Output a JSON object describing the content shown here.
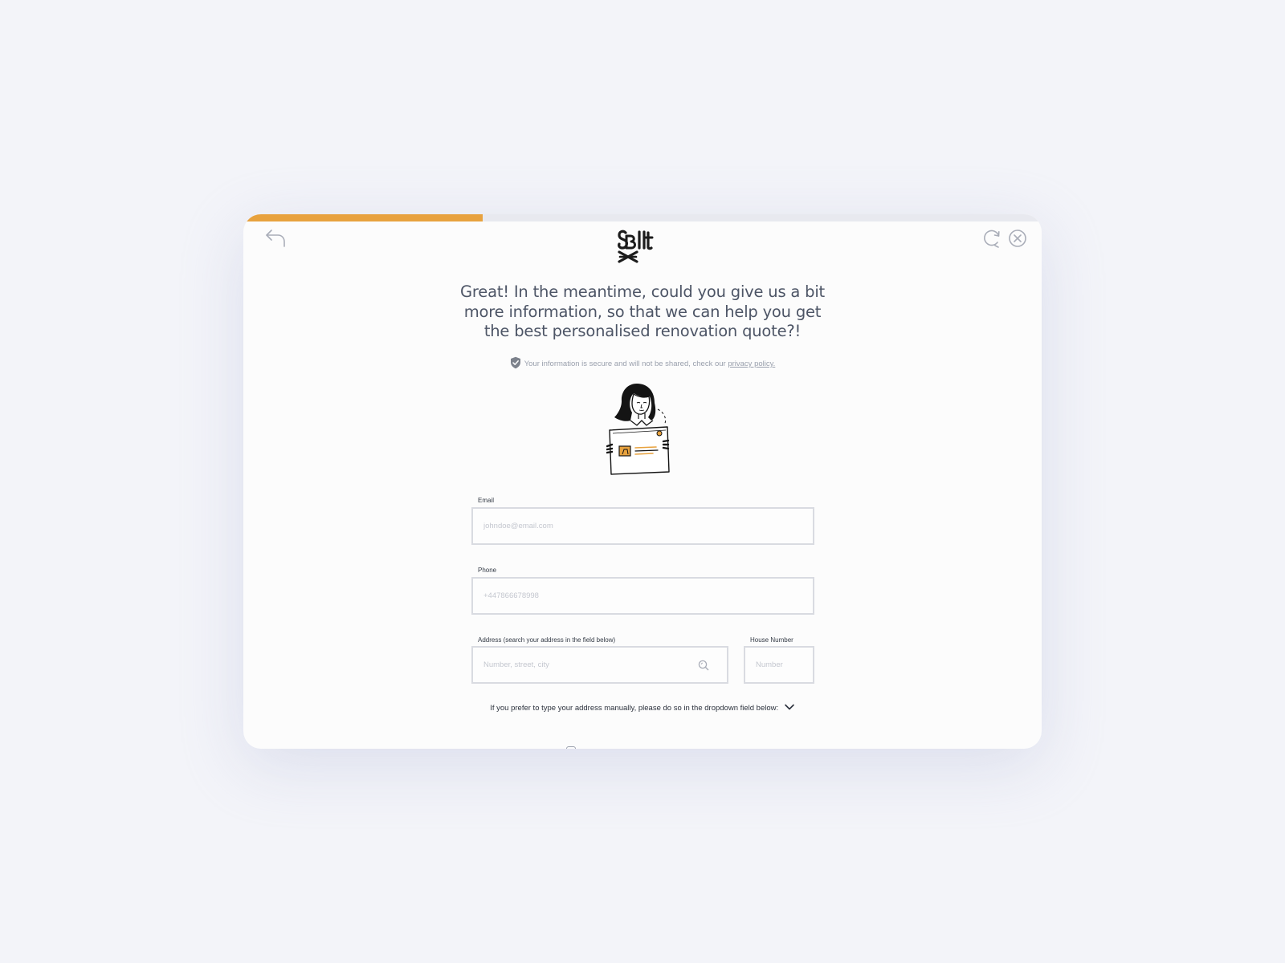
{
  "progress": {
    "value_percent": 30,
    "fill_color": "#e8a23e",
    "track_color": "#e8e9ef"
  },
  "header": {
    "back_icon": "back-arrow-icon",
    "logo_text": "Bilt",
    "refresh_icon": "refresh-icon",
    "close_icon": "close-icon"
  },
  "headline": "Great! In the meantime, could you give us a bit more information, so that we can help you get the best personalised renovation quote?!",
  "secure_note": {
    "icon": "shield-check-icon",
    "text": "Your information is secure and will not be shared, check our ",
    "link_text": "privacy policy."
  },
  "illustration": {
    "icon": "woman-holding-id-card-illustration",
    "accent_color": "#e8a23e"
  },
  "form": {
    "email": {
      "label": "Email",
      "placeholder": "johndoe@email.com",
      "value": ""
    },
    "phone": {
      "label": "Phone",
      "placeholder": "+447866678998",
      "value": ""
    },
    "address": {
      "label": "Address (search your address in the field below)",
      "placeholder": "Number, street, city",
      "value": "",
      "icon": "search-icon"
    },
    "house_number": {
      "label": "House Number",
      "placeholder": "Number",
      "value": ""
    }
  },
  "manual_address": {
    "text": "If you prefer to type your address manually, please do so in the dropdown field below:",
    "icon": "chevron-down-icon"
  }
}
